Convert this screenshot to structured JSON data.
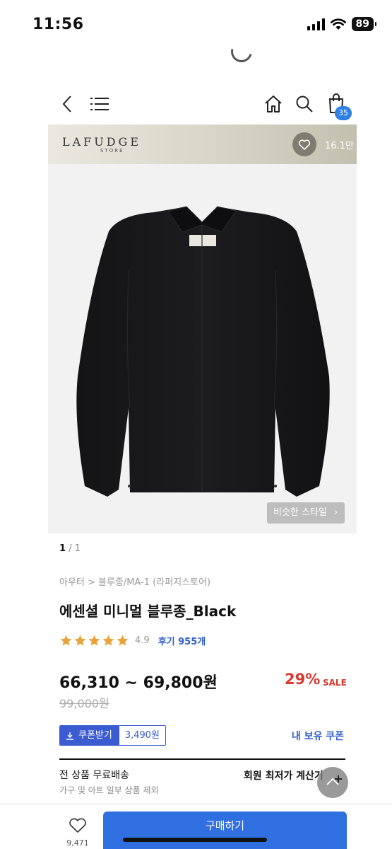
{
  "status_bar": {
    "time": "11:56",
    "battery": "89"
  },
  "header": {
    "cart_count": "35"
  },
  "brand_banner": {
    "brand_name": "LAFUDGE",
    "brand_sub": "STORE",
    "like_count": "16.1만"
  },
  "gallery": {
    "current_page": "1",
    "total_pages": "/ 1",
    "similar_style_label": "비슷한 스타일"
  },
  "product": {
    "breadcrumb": "아우터 > 블루종/MA-1 (라퍼지스토어)",
    "title": "에센셜 미니멀 블루종_Black",
    "rating": "4.9",
    "stars": 5,
    "review_label": "후기 955개",
    "price_range": "66,310 ~ 69,800원",
    "original_price": "99,000원",
    "discount": "29%",
    "sale_label": "SALE"
  },
  "coupon": {
    "button_label": "쿠폰받기",
    "amount": "3,490원",
    "my_coupon_label": "내 보유 쿠폰"
  },
  "shipping": {
    "title": "전 상품 무료배송",
    "subtitle": "가구 및 아트 일부 상품 제외",
    "calc_label": "회원 최저가 계산기"
  },
  "bottom_bar": {
    "wish_count": "9,471",
    "buy_label": "구매하기"
  },
  "colors": {
    "accent_blue": "#2f6fe0",
    "sale_red": "#d63a30",
    "star": "#e8a33c",
    "coupon_blue": "#3b5bd0"
  }
}
